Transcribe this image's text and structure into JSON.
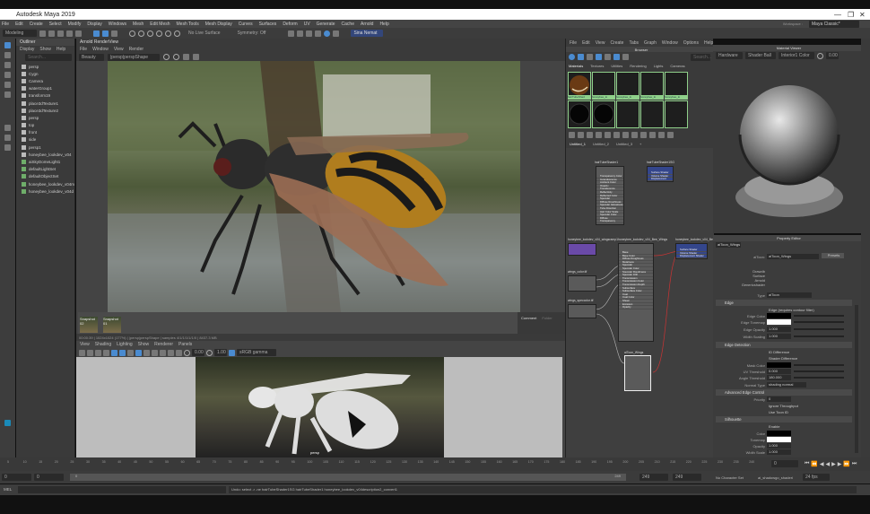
{
  "window": {
    "title": "Autodesk Maya 2019",
    "minimize": "—",
    "restore": "❐",
    "close": "✕"
  },
  "menu": [
    "File",
    "Edit",
    "Create",
    "Select",
    "Modify",
    "Display",
    "Windows",
    "Mesh",
    "Edit Mesh",
    "Mesh Tools",
    "Mesh Display",
    "Curves",
    "Surfaces",
    "Deform",
    "UV",
    "Generate",
    "Cache",
    "Arnold",
    "Help"
  ],
  "workspace": {
    "label": "Workspace :",
    "value": "Maya Classic*"
  },
  "shelf": {
    "mode": "Modeling",
    "live_surface": "No Live Surface",
    "symmetry": "Symmetry: Off",
    "sign_in": "Sina Nemat"
  },
  "outliner": {
    "title": "Outliner",
    "menu": [
      "Display",
      "Show",
      "Help"
    ],
    "search_placeholder": "Search...",
    "items": [
      "persp",
      "Cygn",
      "Camera",
      "waterGroup1",
      "transform19",
      "place3dTexture1",
      "place3dTexture2",
      "persp",
      "top",
      "front",
      "side",
      "persp1",
      "honeybee_lookdev_v04",
      "aiSkyDomeLight1",
      "defaultLightSet",
      "defaultObjectSet",
      "honeybee_lookdev_v04m",
      "honeybee_lookdev_v04d"
    ]
  },
  "renderview": {
    "title": "Arnold RenderView",
    "menu": [
      "File",
      "Window",
      "View",
      "Render"
    ],
    "aov": "Beauty",
    "camera": "|persp|perspShape",
    "snapshots": [
      "Snapshot 02",
      "Snapshot 01"
    ],
    "comment_tabs": [
      "Comment",
      "Folder"
    ],
    "status": "00:00:39 | 1024x1024 (177%) | |persp|perspShape | samples 4/1/1/1/1/1/0 | 8437.3 MB"
  },
  "viewport": {
    "menu": [
      "View",
      "Shading",
      "Lighting",
      "Show",
      "Renderer",
      "Panels"
    ],
    "exposure": "0.00",
    "gamma": "1.00",
    "colorspace": "sRGB gamma",
    "camera_label": "persp"
  },
  "hypershade": {
    "menu": [
      "File",
      "Edit",
      "View",
      "Create",
      "Tabs",
      "Graph",
      "Window",
      "Options",
      "Help"
    ],
    "browser_title": "Browser",
    "search_placeholder": "Search...",
    "tabs": [
      "Materials",
      "Textures",
      "Utilities",
      "Rendering",
      "Lights",
      "Cameras"
    ],
    "swatches": [
      "hairTubeShad",
      "honeybee_lo",
      "honeybee_lo",
      "honeybee_lo",
      "honeybee_lo"
    ],
    "editor_tabs": [
      "Untitled_1",
      "Untitled_2",
      "Untitled_3",
      "+"
    ],
    "nodes": {
      "hair": "hairTubeShader1",
      "hairsg": "hairTubeShader1SG",
      "wings": "honeybee_lookdev_v04_Bee_Wings",
      "wingsg": "honeybee_lookdev_v04_BeeWingsShaderSG",
      "ramp": "honeybee_lookdev_v04_wingsramp1",
      "color": "wings_color.tif",
      "spec": "wings_speccolor.tif",
      "toon": "aiToon_Wings"
    },
    "sg_attrs": [
      "Surface Shader",
      "Volume Shader",
      "Displacement Shader"
    ],
    "hair_attrs": [
      "Transparency Color",
      "Incandescence",
      "Ambient Color",
      "Opacity",
      "Translucence",
      "Reflectivity",
      "Reflected Color",
      "Specular",
      "Diffuse Roughness",
      "Specular Glossiness",
      "Tube Direction",
      "Hair Color Scale",
      "Specular Color",
      "Diffuse",
      "Transparency"
    ],
    "wing_attrs": [
      "Base",
      "Base Color",
      "Diffuse Roughness",
      "Metalness",
      "Specular",
      "Specular Color",
      "Specular Roughness",
      "Specular IOR",
      "Transmission",
      "Transmission Color",
      "Transmission Depth",
      "Subsurface",
      "Subsurface Color",
      "Coat",
      "Coat Color",
      "Sheen",
      "Emission",
      "Opacity"
    ]
  },
  "material_viewer": {
    "title": "Material Viewer",
    "renderer": "Hardware",
    "shape": "Shader Ball",
    "env": "Interior1 Color",
    "exposure": "0.00"
  },
  "property_editor": {
    "title": "Property Editor",
    "node_tab": "aiToon_Wings",
    "type_label": "aiToon:",
    "name_value": "aiToon_Wings",
    "presets": "Presets",
    "classification": [
      "Drawdb",
      "Surface",
      "Arnold",
      "Genericshader"
    ],
    "type_field_label": "Type",
    "type_value": "aiToon",
    "sections": {
      "edge": "Edge",
      "edge_detection": "Edge Detection",
      "advanced": "Advanced Edge Control",
      "silhouette": "Silhouette"
    },
    "edge_contour": "Edge (requires contour filter)",
    "edge_color": "Edge Color",
    "edge_tonemap": "Edge Tonemap",
    "edge_opacity": "Edge Opacity",
    "edge_opacity_val": "1.000",
    "width_scaling": "Width Scaling",
    "width_scaling_val": "1.000",
    "id_diff": "ID Difference",
    "shader_diff": "Shader Difference",
    "mask_color": "Mask Color",
    "uv_threshold": "UV Threshold",
    "uv_threshold_val": "0.000",
    "angle_threshold": "Angle Threshold",
    "angle_threshold_val": "180.000",
    "normal_type": "Normal Type",
    "normal_type_val": "shading normal",
    "priority": "Priority",
    "priority_val": "0",
    "ignore_throughput": "Ignore Throughput",
    "user_id": "Use Toon ID",
    "enable": "Enable",
    "color": "Color",
    "tonemap": "Tonemap",
    "opacity": "Opacity",
    "opacity_val": "1.000",
    "width_scale": "Width Scale",
    "width_scale_val": "1.000"
  },
  "timeline": {
    "ticks": [
      "5",
      "10",
      "15",
      "20",
      "25",
      "30",
      "35",
      "40",
      "45",
      "50",
      "55",
      "60",
      "65",
      "70",
      "75",
      "80",
      "85",
      "90",
      "95",
      "100",
      "105",
      "110",
      "115",
      "120",
      "125",
      "130",
      "135",
      "140",
      "145",
      "150",
      "155",
      "160",
      "165",
      "170",
      "175",
      "180",
      "185",
      "190",
      "195",
      "200",
      "205",
      "210",
      "215",
      "220",
      "225",
      "230",
      "235",
      "240"
    ],
    "current_frame": "0"
  },
  "range": {
    "start": "0",
    "start2": "0",
    "playback_start": "0",
    "end": "249",
    "end2": "249",
    "end3": "249",
    "character_set": "No Character Set",
    "anim_layer": "ai_shadowgo_shaderi",
    "fps": "24 fps"
  },
  "command": {
    "label": "MEL",
    "result": "Undo: select -r -ne hairTubeShader1SG hairTubeShader1 honeybee_lookdev_v04description2_convert1"
  }
}
